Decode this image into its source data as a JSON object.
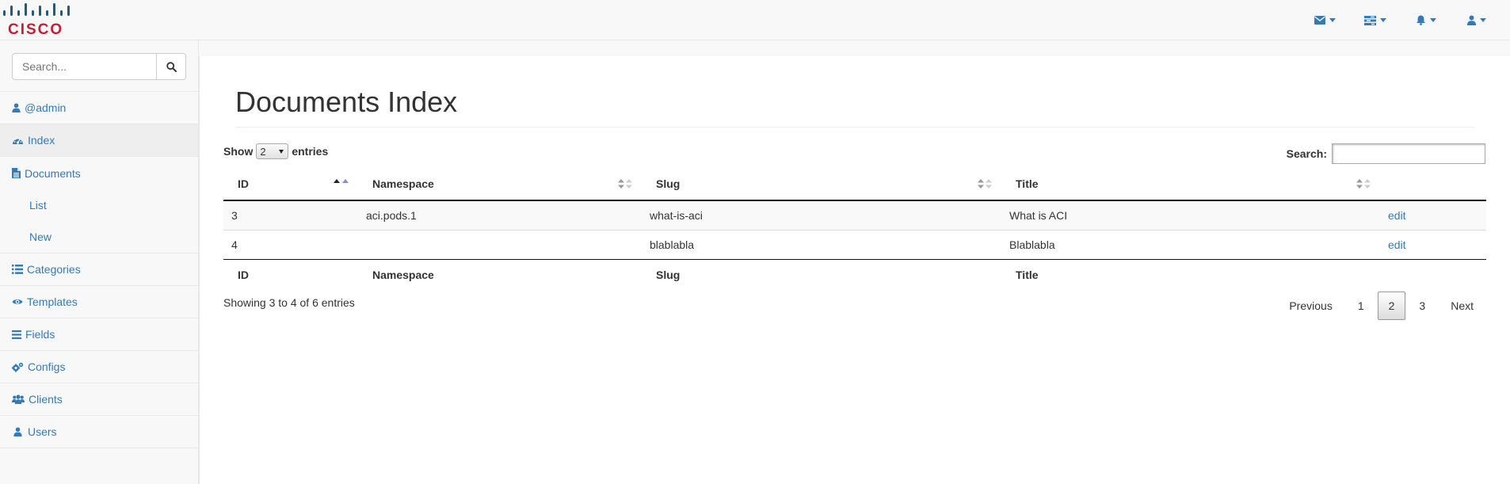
{
  "brand": {
    "name": "CISCO",
    "logo_color": "#c41e3a",
    "bars_color": "#1f5a86"
  },
  "topnav": [
    {
      "icon": "envelope-icon"
    },
    {
      "icon": "tasks-icon"
    },
    {
      "icon": "bell-icon"
    },
    {
      "icon": "user-icon"
    }
  ],
  "sidebar": {
    "search_placeholder": "Search...",
    "items": [
      {
        "label": "@admin",
        "icon": "user-icon"
      },
      {
        "label": "Index",
        "icon": "dashboard-icon"
      },
      {
        "label": "Documents",
        "icon": "file-icon",
        "children": [
          "List",
          "New"
        ]
      },
      {
        "label": "Categories",
        "icon": "list-icon"
      },
      {
        "label": "Templates",
        "icon": "eye-icon"
      },
      {
        "label": "Fields",
        "icon": "bars-icon"
      },
      {
        "label": "Configs",
        "icon": "cogs-icon"
      },
      {
        "label": "Clients",
        "icon": "users-icon"
      },
      {
        "label": "Users",
        "icon": "user-icon"
      }
    ]
  },
  "main": {
    "title": "Documents Index",
    "length": {
      "show": "Show",
      "value": "2",
      "entries": "entries"
    },
    "filter_label": "Search:",
    "columns": [
      "ID",
      "Namespace",
      "Slug",
      "Title"
    ],
    "rows": [
      {
        "id": "3",
        "namespace": "aci.pods.1",
        "slug": "what-is-aci",
        "title": "What is ACI",
        "action": "edit"
      },
      {
        "id": "4",
        "namespace": "",
        "slug": "blablabla",
        "title": "Blablabla",
        "action": "edit"
      }
    ],
    "info": "Showing 3 to 4 of 6 entries",
    "paging": {
      "previous": "Previous",
      "pages": [
        "1",
        "2",
        "3"
      ],
      "current": "2",
      "next": "Next"
    }
  },
  "colors": {
    "link": "#337ab7"
  }
}
